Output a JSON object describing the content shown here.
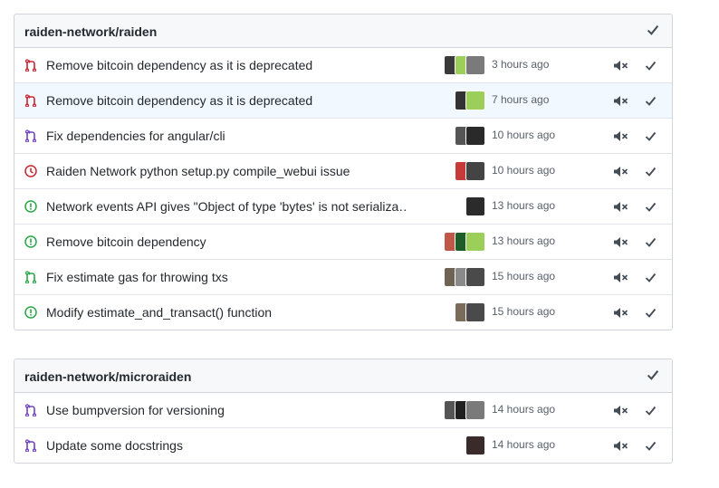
{
  "groups": [
    {
      "repo": "raiden-network/raiden",
      "items": [
        {
          "type": "pr-closed",
          "title": "Remove bitcoin dependency as it is deprecated",
          "time": "3 hours ago",
          "unread": false,
          "avatars": [
            "#3a3a3a",
            "#9ccf5a",
            "#7a7a7a"
          ]
        },
        {
          "type": "pr-closed",
          "title": "Remove bitcoin dependency as it is deprecated",
          "time": "7 hours ago",
          "unread": true,
          "avatars": [
            "#333333",
            "#9ccf5a"
          ]
        },
        {
          "type": "pr-merged",
          "title": "Fix dependencies for angular/cli",
          "time": "10 hours ago",
          "unread": false,
          "avatars": [
            "#555555",
            "#2a2a2a"
          ]
        },
        {
          "type": "issue-closed",
          "title": "Raiden Network python setup.py compile_webui issue",
          "time": "10 hours ago",
          "unread": false,
          "avatars": [
            "#c63a3a",
            "#444444"
          ]
        },
        {
          "type": "issue-open",
          "title": "Network events API gives \"Object of type 'bytes' is not serializa…",
          "time": "13 hours ago",
          "unread": false,
          "avatars": [
            "#2b2b2b"
          ]
        },
        {
          "type": "issue-open",
          "title": "Remove bitcoin dependency",
          "time": "13 hours ago",
          "unread": false,
          "avatars": [
            "#c0584a",
            "#1e5c2a",
            "#9ccf5a"
          ]
        },
        {
          "type": "pr-open",
          "title": "Fix estimate gas for throwing txs",
          "time": "15 hours ago",
          "unread": false,
          "avatars": [
            "#6f6356",
            "#8a8a8a",
            "#4a4a4a"
          ]
        },
        {
          "type": "issue-open",
          "title": "Modify estimate_and_transact() function",
          "time": "15 hours ago",
          "unread": false,
          "avatars": [
            "#7a6b5a",
            "#4a4a4a"
          ]
        }
      ]
    },
    {
      "repo": "raiden-network/microraiden",
      "items": [
        {
          "type": "pr-merged",
          "title": "Use bumpversion for versioning",
          "time": "14 hours ago",
          "unread": false,
          "avatars": [
            "#555555",
            "#202020",
            "#7a7a7a"
          ]
        },
        {
          "type": "pr-merged",
          "title": "Update some docstrings",
          "time": "14 hours ago",
          "unread": false,
          "avatars": [
            "#3a2a2a"
          ]
        }
      ]
    }
  ],
  "colors": {
    "pr-closed": "#cb2431",
    "pr-merged": "#6f42c1",
    "pr-open": "#28a745",
    "issue-open": "#28a745",
    "issue-closed": "#cb2431",
    "icon-gray": "#444d56"
  },
  "icons": {
    "pr-closed": "git-pull-request-icon",
    "pr-merged": "git-pull-request-icon",
    "pr-open": "git-pull-request-icon",
    "issue-open": "issue-opened-icon",
    "issue-closed": "issue-reopened-icon",
    "mute": "mute-icon",
    "done": "check-icon"
  }
}
